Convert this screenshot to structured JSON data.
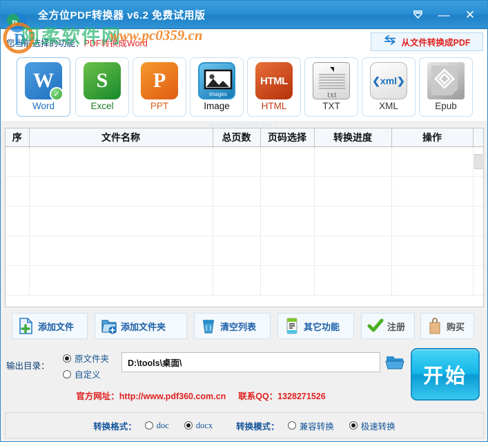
{
  "window": {
    "title": "全方位PDF转换器 v6.2 免费试用版",
    "collapse_icon": "collapse-down-icon",
    "minimize_label": "—",
    "close_label": "✕"
  },
  "watermark": {
    "site_cn": "www.pc0359.cn",
    "site_hanzi": "阿柔软件网",
    "table_site": "www.pHome.NET"
  },
  "function_row": {
    "prefix": "您当前选择的功能：",
    "current": "PDF转换成Word",
    "reverse_button": "从文件转换成PDF",
    "reverse_icon": "swap-arrows-icon"
  },
  "converters": [
    {
      "id": "word",
      "label": "Word",
      "glyph": "W",
      "label_color": "#1a6fc0",
      "selected": true
    },
    {
      "id": "excel",
      "label": "Excel",
      "glyph": "S",
      "label_color": "#1d7a2a",
      "selected": false
    },
    {
      "id": "ppt",
      "label": "PPT",
      "glyph": "P",
      "label_color": "#e05c12",
      "selected": false
    },
    {
      "id": "image",
      "label": "Image",
      "glyph": "images",
      "label_color": "#111111",
      "selected": false
    },
    {
      "id": "html",
      "label": "HTML",
      "glyph": "HTML",
      "label_color": "#c0390f",
      "selected": false
    },
    {
      "id": "txt",
      "label": "TXT",
      "glyph": "txt",
      "label_color": "#333333",
      "selected": false
    },
    {
      "id": "xml",
      "label": "XML",
      "glyph": "❮xml❯",
      "label_color": "#333333",
      "selected": false
    },
    {
      "id": "epub",
      "label": "Epub",
      "glyph": "◇",
      "label_color": "#333333",
      "selected": false
    }
  ],
  "file_table": {
    "columns": [
      "序",
      "文件名称",
      "总页数",
      "页码选择",
      "转换进度",
      "操作"
    ],
    "rows": [],
    "empty_row_count": 5
  },
  "actions": [
    {
      "id": "add-file",
      "label": "添加文件",
      "icon": "file-plus-icon"
    },
    {
      "id": "add-folder",
      "label": "添加文件夹",
      "icon": "folder-plus-icon"
    },
    {
      "id": "clear-list",
      "label": "清空列表",
      "icon": "trash-icon"
    },
    {
      "id": "other-func",
      "label": "其它功能",
      "icon": "list-icon"
    },
    {
      "id": "register",
      "label": "注册",
      "icon": "check-icon"
    },
    {
      "id": "purchase",
      "label": "购买",
      "icon": "shopping-bag-icon"
    }
  ],
  "output": {
    "label": "输出目录：",
    "radios": [
      {
        "id": "source-folder",
        "label": "原文件夹",
        "checked": true
      },
      {
        "id": "custom-folder",
        "label": "自定义",
        "checked": false
      }
    ],
    "path_value": "D:\\tools\\桌面\\",
    "browse_icon": "folder-open-icon",
    "start_label": "开始"
  },
  "contact": {
    "website_label": "官方网址：",
    "website": "http://www.pdf360.com.cn",
    "qq_label": "联系QQ：",
    "qq": "1328271526"
  },
  "bottom_bar": {
    "format_label": "转换格式：",
    "formats": [
      {
        "id": "doc",
        "label": "doc",
        "checked": false
      },
      {
        "id": "docx",
        "label": "docx",
        "checked": true
      }
    ],
    "mode_label": "转换模式：",
    "modes": [
      {
        "id": "compat",
        "label": "兼容转换",
        "checked": false
      },
      {
        "id": "fast",
        "label": "极速转换",
        "checked": true
      }
    ]
  },
  "colors": {
    "title_bar": "#2a8fd4",
    "accent_red": "#e0201f",
    "accent_blue": "#14549a",
    "start_button": "#15b6e8"
  }
}
